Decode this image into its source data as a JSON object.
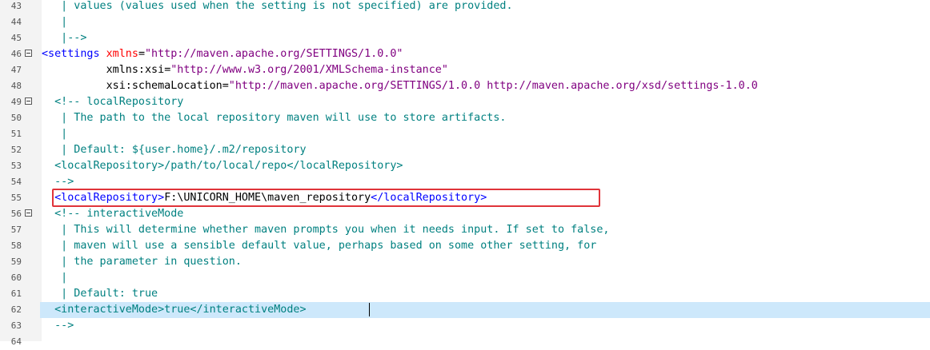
{
  "editor": {
    "lines": [
      {
        "num": "43",
        "fold": false,
        "segs": [
          [
            "cm",
            "   | values (values used when the setting is not specified) are provided."
          ]
        ]
      },
      {
        "num": "44",
        "fold": false,
        "segs": [
          [
            "cm",
            "   |"
          ]
        ]
      },
      {
        "num": "45",
        "fold": false,
        "segs": [
          [
            "cm",
            "   |-->"
          ]
        ]
      },
      {
        "num": "46",
        "fold": true,
        "segs": [
          [
            "tg",
            "<settings "
          ],
          [
            "at",
            "xmlns"
          ],
          [
            "tx",
            "="
          ],
          [
            "st",
            "\"http://maven.apache.org/SETTINGS/1.0.0\""
          ]
        ]
      },
      {
        "num": "47",
        "fold": false,
        "segs": [
          [
            "tx",
            "          xmlns:xsi"
          ],
          [
            "tx",
            "="
          ],
          [
            "st",
            "\"http://www.w3.org/2001/XMLSchema-instance\""
          ]
        ]
      },
      {
        "num": "48",
        "fold": false,
        "segs": [
          [
            "tx",
            "          xsi:schemaLocation"
          ],
          [
            "tx",
            "="
          ],
          [
            "st",
            "\"http://maven.apache.org/SETTINGS/1.0.0 http://maven.apache.org/xsd/settings-1.0.0"
          ]
        ]
      },
      {
        "num": "49",
        "fold": true,
        "segs": [
          [
            "cm",
            "  <!-- localRepository"
          ]
        ]
      },
      {
        "num": "50",
        "fold": false,
        "segs": [
          [
            "cm",
            "   | The path to the local repository maven will use to store artifacts."
          ]
        ]
      },
      {
        "num": "51",
        "fold": false,
        "segs": [
          [
            "cm",
            "   |"
          ]
        ]
      },
      {
        "num": "52",
        "fold": false,
        "segs": [
          [
            "cm",
            "   | Default: ${user.home}/.m2/repository"
          ]
        ]
      },
      {
        "num": "53",
        "fold": false,
        "segs": [
          [
            "cm",
            "  <localRepository>/path/to/local/repo</localRepository>"
          ]
        ]
      },
      {
        "num": "54",
        "fold": false,
        "segs": [
          [
            "cm",
            "  -->"
          ]
        ]
      },
      {
        "num": "55",
        "fold": false,
        "segs": [
          [
            "tx",
            "  "
          ],
          [
            "tg",
            "<localRepository>"
          ],
          [
            "tx",
            "F:\\UNICORN_HOME\\maven_repository"
          ],
          [
            "tg",
            "</localRepository>"
          ]
        ]
      },
      {
        "num": "56",
        "fold": true,
        "segs": [
          [
            "cm",
            "  <!-- interactiveMode"
          ]
        ]
      },
      {
        "num": "57",
        "fold": false,
        "segs": [
          [
            "cm",
            "   | This will determine whether maven prompts you when it needs input. If set to false,"
          ]
        ]
      },
      {
        "num": "58",
        "fold": false,
        "segs": [
          [
            "cm",
            "   | maven will use a sensible default value, perhaps based on some other setting, for"
          ]
        ]
      },
      {
        "num": "59",
        "fold": false,
        "segs": [
          [
            "cm",
            "   | the parameter in question."
          ]
        ]
      },
      {
        "num": "60",
        "fold": false,
        "segs": [
          [
            "cm",
            "   |"
          ]
        ]
      },
      {
        "num": "61",
        "fold": false,
        "segs": [
          [
            "cm",
            "   | Default: true"
          ]
        ]
      },
      {
        "num": "62",
        "fold": false,
        "current": true,
        "segs": [
          [
            "cm",
            "  <interactiveMode>true</interactiveMode>"
          ]
        ]
      },
      {
        "num": "63",
        "fold": false,
        "segs": [
          [
            "cm",
            "  -->"
          ]
        ]
      },
      {
        "num": "64",
        "fold": false,
        "segs": []
      }
    ]
  },
  "colors": {
    "comment": "#008080",
    "tag": "#0000ff",
    "attribute": "#ff0000",
    "string": "#800080",
    "current_line": "#cde8fb",
    "highlight_box": "#e0343a"
  }
}
